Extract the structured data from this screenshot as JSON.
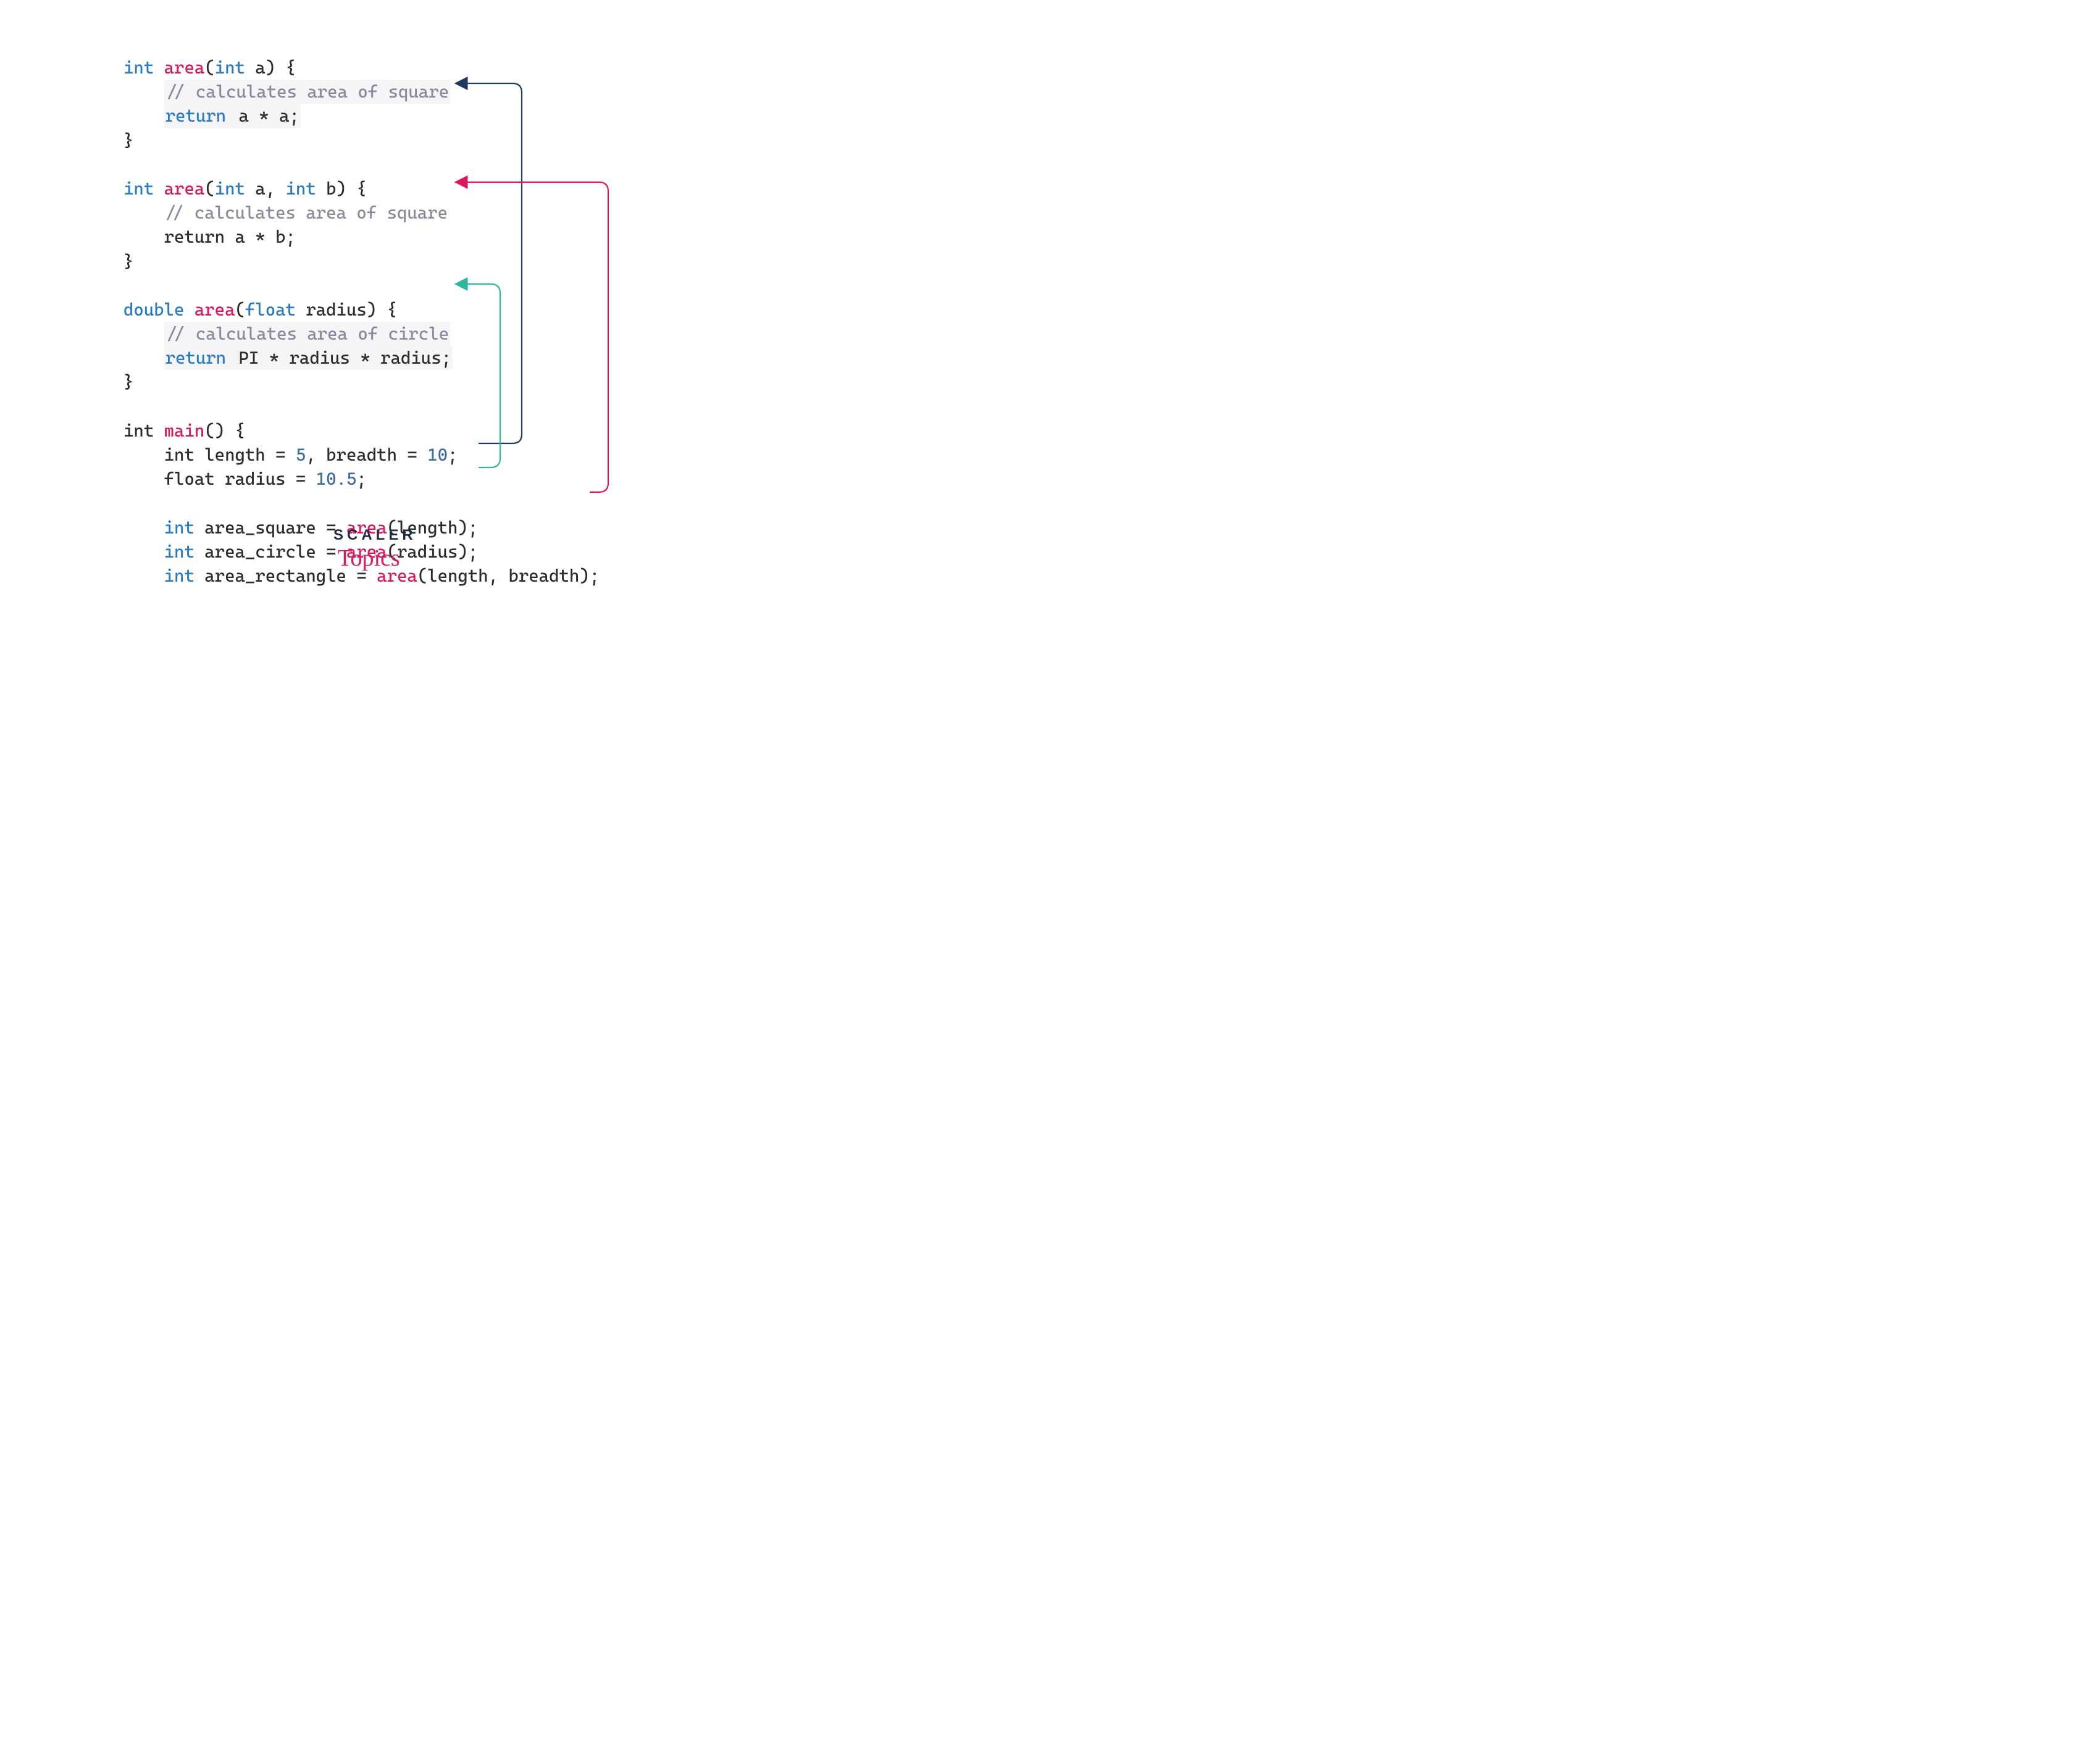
{
  "code": {
    "func1": {
      "sig_int1": "int",
      "sig_name": "area",
      "sig_open": "(",
      "sig_int2": "int",
      "sig_param": " a) {",
      "comment": "// calculates area of square",
      "ret_kw": "return",
      "ret_expr": " a * a;",
      "close": "}"
    },
    "func2": {
      "sig_int1": "int",
      "sig_name": "area",
      "sig_open": "(",
      "sig_int2": "int",
      "sig_mid": " a, ",
      "sig_int3": "int",
      "sig_param": " b) {",
      "comment": "// calculates area of square",
      "ret_expr": "    return a * b;",
      "close": "}"
    },
    "func3": {
      "sig_dbl": "double",
      "sig_name": "area",
      "sig_open": "(",
      "sig_float": "float",
      "sig_param": " radius) {",
      "comment": "// calculates area of circle",
      "ret_kw": "return",
      "ret_expr": " PI * radius * radius;",
      "close": "}"
    },
    "main": {
      "sig_int": "int",
      "sig_name": "main",
      "sig_rest": "() {",
      "l_int": "int",
      "l_decl1": " length = ",
      "l_num1": "5",
      "l_decl2": ", breadth = ",
      "l_num2": "10",
      "l_semi1": ";",
      "f_float": "float",
      "f_decl": " radius = ",
      "f_num": "10.5",
      "f_semi": ";",
      "a1_int": "int",
      "a1_lhs": " area_square = ",
      "a1_fn": "area",
      "a1_args": "(length);",
      "a2_int": "int",
      "a2_lhs": " area_circle = ",
      "a2_fn": "area",
      "a2_args": "(radius);",
      "a3_int": "int",
      "a3_lhs": " area_rectangle = ",
      "a3_fn": "area",
      "a3_args": "(length, breadth);"
    }
  },
  "logo": {
    "top": "SCALER",
    "bottom": "Topics"
  },
  "arrows": {
    "colors": {
      "square": "#1f3a5f",
      "rectangle": "#d71a60",
      "circle": "#2fb5a0"
    }
  }
}
